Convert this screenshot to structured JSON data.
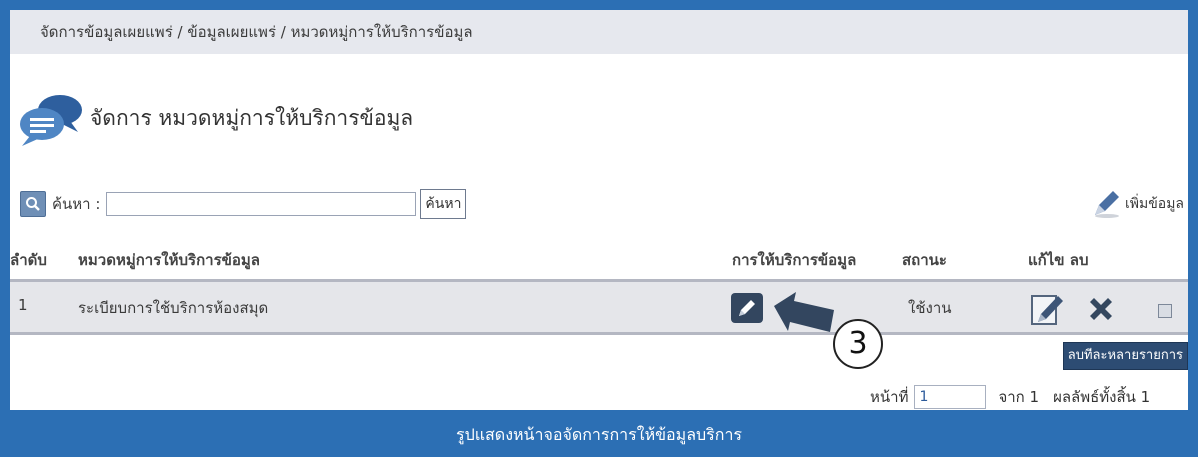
{
  "breadcrumb": "จัดการข้อมูลเผยแพร่ / ข้อมูลเผยแพร่ / หมวดหมู่การให้บริการข้อมูล",
  "page_title": "จัดการ หมวดหมู่การให้บริการข้อมูล",
  "search": {
    "label": "ค้นหา :",
    "value": "",
    "button_label": "ค้นหา"
  },
  "add_label": "เพิ่มข้อมูล",
  "table": {
    "headers": {
      "order": "ลำดับ",
      "category": "หมวดหมู่การให้บริการข้อมูล",
      "service": "การให้บริการข้อมูล",
      "status": "สถานะ",
      "edit_delete": "แก้ไข ลบ"
    },
    "rows": [
      {
        "order": "1",
        "category": "ระเบียบการใช้บริการห้องสมุด",
        "status": "ใช้งาน"
      }
    ]
  },
  "annotation_step": "3",
  "delete_multi_label": "ลบทีละหลายรายการ",
  "pager": {
    "page_label": "หน้าที่",
    "page_value": "1",
    "of_label": "จาก 1",
    "total_label": "ผลลัพธ์ทั้งสิ้น 1"
  },
  "caption": "รูปแสดงหน้าจอจัดการการให้ข้อมูลบริการ",
  "colors": {
    "frame": "#2c6fb4",
    "row_bg": "#e5e6ea",
    "breadcrumb_bg": "#e6e8ee",
    "dark_button": "#2d4c73"
  }
}
